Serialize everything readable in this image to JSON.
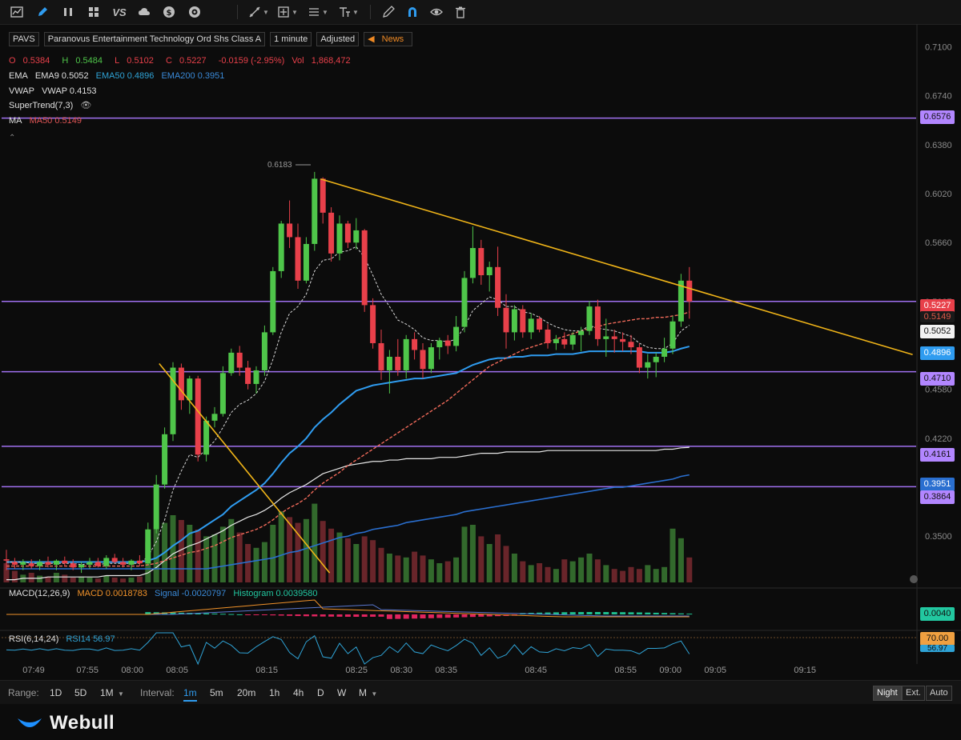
{
  "toolbar": {
    "left_icons": [
      "chart-icon",
      "pencil-icon",
      "bars-icon",
      "grid-icon",
      "vs-icon",
      "cloud-icon",
      "dollar-icon",
      "target-icon"
    ],
    "vs_label": "VS",
    "right_icons": [
      "trendline-icon",
      "measure-icon",
      "fib-icon",
      "text-icon",
      "brush-icon",
      "magnet-icon",
      "eye-icon",
      "trash-icon"
    ]
  },
  "header": {
    "symbol": "PAVS",
    "name": "Paranovus Entertainment Technology Ord Shs Class A",
    "interval": "1 minute",
    "adjusted": "Adjusted",
    "news": "News"
  },
  "ohlc": {
    "o_label": "O",
    "o": "0.5384",
    "h_label": "H",
    "h": "0.5484",
    "l_label": "L",
    "l": "0.5102",
    "c_label": "C",
    "c": "0.5227",
    "change": "-0.0159 (-2.95%)",
    "vol_label": "Vol",
    "vol": "1,868,472"
  },
  "indicators": {
    "ema_label": "EMA",
    "ema9": "EMA9 0.5052",
    "ema50": "EMA50 0.4896",
    "ema200": "EMA200 0.3951",
    "vwap_label": "VWAP",
    "vwap": "VWAP 0.4153",
    "supertrend": "SuperTrend(7,3)",
    "ma_label": "MA",
    "ma50": "MA50 0.5149"
  },
  "macd_info": {
    "label": "MACD(12,26,9)",
    "macd": "MACD 0.0018783",
    "signal": "Signal -0.0020797",
    "histogram": "Histogram 0.0039580",
    "tag": "0.0040"
  },
  "rsi_info": {
    "label": "RSI(6,14,24)",
    "rsi14": "RSI14 56.97",
    "tag": "70.00",
    "tag2": "56.97"
  },
  "price_tags": {
    "t6576": "0.6576",
    "t5227": "0.5227",
    "t5149": "0.5149",
    "t5052": "0.5052",
    "t4896": "0.4896",
    "t4710": "0.4710",
    "t4161": "0.4161",
    "t3951": "0.3951",
    "t3864": "0.3864"
  },
  "high_label": "0.6183",
  "colors": {
    "up": "#4fc64a",
    "down": "#e8404a",
    "hline": "#a070f0",
    "trend": "#f0b418",
    "ema9": "#d8d8d8",
    "ema50": "#2f9cf0",
    "ema200": "#2a6fd0",
    "vwap": "#e8e8e8",
    "ma50": "#f06a5a"
  },
  "chart_data": {
    "type": "candlestick",
    "y_ticks": [
      "0.7100",
      "0.6740",
      "0.6380",
      "0.6020",
      "0.5660",
      "0.5227",
      "0.4580",
      "0.4220",
      "0.3500"
    ],
    "ylim": [
      0.316,
      0.728
    ],
    "x_ticks": [
      "07:49",
      "07:55",
      "08:00",
      "08:05",
      "08:15",
      "08:25",
      "08:30",
      "08:35",
      "08:45",
      "08:55",
      "09:00",
      "09:05",
      "09:15"
    ],
    "horizontal_lines": [
      0.6576,
      0.5227,
      0.471,
      0.4161,
      0.3864
    ],
    "trendlines": [
      {
        "from": [
          "08:03",
          0.477
        ],
        "to": [
          "08:22",
          0.323
        ]
      },
      {
        "from": [
          "08:21",
          0.6128
        ],
        "to": [
          "09:27",
          0.4836
        ]
      }
    ],
    "candles": [
      {
        "o": 0.333,
        "h": 0.34,
        "l": 0.325,
        "c": 0.332
      },
      {
        "o": 0.331,
        "h": 0.334,
        "l": 0.326,
        "c": 0.329
      },
      {
        "o": 0.329,
        "h": 0.333,
        "l": 0.325,
        "c": 0.331
      },
      {
        "o": 0.33,
        "h": 0.333,
        "l": 0.326,
        "c": 0.328
      },
      {
        "o": 0.328,
        "h": 0.333,
        "l": 0.325,
        "c": 0.331
      },
      {
        "o": 0.331,
        "h": 0.335,
        "l": 0.327,
        "c": 0.329
      },
      {
        "o": 0.329,
        "h": 0.333,
        "l": 0.325,
        "c": 0.332
      },
      {
        "o": 0.332,
        "h": 0.335,
        "l": 0.328,
        "c": 0.33
      },
      {
        "o": 0.33,
        "h": 0.333,
        "l": 0.325,
        "c": 0.327
      },
      {
        "o": 0.327,
        "h": 0.331,
        "l": 0.323,
        "c": 0.329
      },
      {
        "o": 0.329,
        "h": 0.334,
        "l": 0.326,
        "c": 0.331
      },
      {
        "o": 0.331,
        "h": 0.334,
        "l": 0.327,
        "c": 0.328
      },
      {
        "o": 0.328,
        "h": 0.336,
        "l": 0.326,
        "c": 0.334
      },
      {
        "o": 0.334,
        "h": 0.337,
        "l": 0.33,
        "c": 0.331
      },
      {
        "o": 0.331,
        "h": 0.334,
        "l": 0.327,
        "c": 0.329
      },
      {
        "o": 0.329,
        "h": 0.333,
        "l": 0.325,
        "c": 0.332
      },
      {
        "o": 0.332,
        "h": 0.336,
        "l": 0.328,
        "c": 0.33
      },
      {
        "o": 0.33,
        "h": 0.36,
        "l": 0.329,
        "c": 0.355
      },
      {
        "o": 0.355,
        "h": 0.395,
        "l": 0.352,
        "c": 0.388
      },
      {
        "o": 0.388,
        "h": 0.43,
        "l": 0.385,
        "c": 0.425
      },
      {
        "o": 0.425,
        "h": 0.478,
        "l": 0.42,
        "c": 0.474
      },
      {
        "o": 0.474,
        "h": 0.477,
        "l": 0.443,
        "c": 0.45
      },
      {
        "o": 0.45,
        "h": 0.468,
        "l": 0.44,
        "c": 0.466
      },
      {
        "o": 0.466,
        "h": 0.468,
        "l": 0.405,
        "c": 0.41
      },
      {
        "o": 0.41,
        "h": 0.438,
        "l": 0.405,
        "c": 0.435
      },
      {
        "o": 0.435,
        "h": 0.445,
        "l": 0.43,
        "c": 0.44
      },
      {
        "o": 0.44,
        "h": 0.475,
        "l": 0.438,
        "c": 0.47
      },
      {
        "o": 0.47,
        "h": 0.488,
        "l": 0.468,
        "c": 0.485
      },
      {
        "o": 0.485,
        "h": 0.49,
        "l": 0.468,
        "c": 0.474
      },
      {
        "o": 0.474,
        "h": 0.479,
        "l": 0.458,
        "c": 0.462
      },
      {
        "o": 0.462,
        "h": 0.475,
        "l": 0.455,
        "c": 0.472
      },
      {
        "o": 0.472,
        "h": 0.505,
        "l": 0.468,
        "c": 0.5
      },
      {
        "o": 0.5,
        "h": 0.548,
        "l": 0.498,
        "c": 0.545
      },
      {
        "o": 0.545,
        "h": 0.582,
        "l": 0.54,
        "c": 0.58
      },
      {
        "o": 0.58,
        "h": 0.597,
        "l": 0.562,
        "c": 0.57
      },
      {
        "o": 0.57,
        "h": 0.58,
        "l": 0.532,
        "c": 0.538
      },
      {
        "o": 0.538,
        "h": 0.57,
        "l": 0.536,
        "c": 0.565
      },
      {
        "o": 0.565,
        "h": 0.618,
        "l": 0.56,
        "c": 0.613
      },
      {
        "o": 0.613,
        "h": 0.614,
        "l": 0.58,
        "c": 0.588
      },
      {
        "o": 0.588,
        "h": 0.592,
        "l": 0.552,
        "c": 0.558
      },
      {
        "o": 0.558,
        "h": 0.586,
        "l": 0.553,
        "c": 0.58
      },
      {
        "o": 0.58,
        "h": 0.582,
        "l": 0.562,
        "c": 0.566
      },
      {
        "o": 0.566,
        "h": 0.584,
        "l": 0.561,
        "c": 0.575
      },
      {
        "o": 0.575,
        "h": 0.576,
        "l": 0.515,
        "c": 0.52
      },
      {
        "o": 0.52,
        "h": 0.525,
        "l": 0.488,
        "c": 0.492
      },
      {
        "o": 0.492,
        "h": 0.502,
        "l": 0.465,
        "c": 0.472
      },
      {
        "o": 0.472,
        "h": 0.487,
        "l": 0.455,
        "c": 0.482
      },
      {
        "o": 0.482,
        "h": 0.495,
        "l": 0.468,
        "c": 0.472
      },
      {
        "o": 0.472,
        "h": 0.498,
        "l": 0.466,
        "c": 0.495
      },
      {
        "o": 0.495,
        "h": 0.5,
        "l": 0.48,
        "c": 0.487
      },
      {
        "o": 0.487,
        "h": 0.492,
        "l": 0.466,
        "c": 0.473
      },
      {
        "o": 0.473,
        "h": 0.492,
        "l": 0.47,
        "c": 0.489
      },
      {
        "o": 0.489,
        "h": 0.496,
        "l": 0.48,
        "c": 0.494
      },
      {
        "o": 0.494,
        "h": 0.498,
        "l": 0.484,
        "c": 0.49
      },
      {
        "o": 0.49,
        "h": 0.512,
        "l": 0.486,
        "c": 0.504
      },
      {
        "o": 0.504,
        "h": 0.545,
        "l": 0.5,
        "c": 0.54
      },
      {
        "o": 0.54,
        "h": 0.578,
        "l": 0.536,
        "c": 0.562
      },
      {
        "o": 0.562,
        "h": 0.568,
        "l": 0.535,
        "c": 0.542
      },
      {
        "o": 0.542,
        "h": 0.552,
        "l": 0.53,
        "c": 0.548
      },
      {
        "o": 0.548,
        "h": 0.563,
        "l": 0.512,
        "c": 0.518
      },
      {
        "o": 0.518,
        "h": 0.528,
        "l": 0.488,
        "c": 0.5
      },
      {
        "o": 0.5,
        "h": 0.52,
        "l": 0.494,
        "c": 0.517
      },
      {
        "o": 0.517,
        "h": 0.52,
        "l": 0.496,
        "c": 0.5
      },
      {
        "o": 0.5,
        "h": 0.514,
        "l": 0.495,
        "c": 0.51
      },
      {
        "o": 0.51,
        "h": 0.512,
        "l": 0.5,
        "c": 0.502
      },
      {
        "o": 0.502,
        "h": 0.506,
        "l": 0.488,
        "c": 0.492
      },
      {
        "o": 0.492,
        "h": 0.498,
        "l": 0.487,
        "c": 0.495
      },
      {
        "o": 0.495,
        "h": 0.5,
        "l": 0.488,
        "c": 0.491
      },
      {
        "o": 0.491,
        "h": 0.5,
        "l": 0.487,
        "c": 0.498
      },
      {
        "o": 0.498,
        "h": 0.504,
        "l": 0.486,
        "c": 0.501
      },
      {
        "o": 0.501,
        "h": 0.523,
        "l": 0.498,
        "c": 0.519
      },
      {
        "o": 0.519,
        "h": 0.524,
        "l": 0.49,
        "c": 0.495
      },
      {
        "o": 0.495,
        "h": 0.51,
        "l": 0.482,
        "c": 0.497
      },
      {
        "o": 0.497,
        "h": 0.502,
        "l": 0.485,
        "c": 0.495
      },
      {
        "o": 0.495,
        "h": 0.5,
        "l": 0.486,
        "c": 0.493
      },
      {
        "o": 0.493,
        "h": 0.498,
        "l": 0.484,
        "c": 0.489
      },
      {
        "o": 0.489,
        "h": 0.492,
        "l": 0.47,
        "c": 0.474
      },
      {
        "o": 0.474,
        "h": 0.484,
        "l": 0.466,
        "c": 0.478
      },
      {
        "o": 0.478,
        "h": 0.485,
        "l": 0.467,
        "c": 0.482
      },
      {
        "o": 0.482,
        "h": 0.496,
        "l": 0.478,
        "c": 0.488
      },
      {
        "o": 0.488,
        "h": 0.512,
        "l": 0.484,
        "c": 0.508
      },
      {
        "o": 0.508,
        "h": 0.543,
        "l": 0.504,
        "c": 0.538
      },
      {
        "o": 0.538,
        "h": 0.548,
        "l": 0.51,
        "c": 0.5227
      }
    ],
    "volumes": [
      0.2,
      0.12,
      0.08,
      0.1,
      0.07,
      0.06,
      0.1,
      0.08,
      0.05,
      0.06,
      0.05,
      0.04,
      0.07,
      0.05,
      0.04,
      0.05,
      0.06,
      0.42,
      0.55,
      0.62,
      0.7,
      0.65,
      0.6,
      0.55,
      0.48,
      0.5,
      0.58,
      0.66,
      0.52,
      0.4,
      0.36,
      0.42,
      0.6,
      0.74,
      0.68,
      0.62,
      0.66,
      0.82,
      0.64,
      0.56,
      0.52,
      0.46,
      0.4,
      0.48,
      0.44,
      0.36,
      0.3,
      0.28,
      0.26,
      0.32,
      0.28,
      0.24,
      0.2,
      0.22,
      0.26,
      0.58,
      0.6,
      0.48,
      0.4,
      0.5,
      0.38,
      0.3,
      0.22,
      0.18,
      0.2,
      0.16,
      0.14,
      0.24,
      0.22,
      0.26,
      0.3,
      0.24,
      0.18,
      0.14,
      0.12,
      0.16,
      0.14,
      0.18,
      0.14,
      0.16,
      0.56,
      0.46,
      0.26
    ],
    "ema9": [
      0.331,
      0.331,
      0.331,
      0.33,
      0.33,
      0.33,
      0.33,
      0.33,
      0.33,
      0.329,
      0.33,
      0.329,
      0.33,
      0.33,
      0.33,
      0.33,
      0.33,
      0.335,
      0.346,
      0.362,
      0.384,
      0.398,
      0.41,
      0.408,
      0.414,
      0.42,
      0.43,
      0.441,
      0.447,
      0.45,
      0.455,
      0.464,
      0.48,
      0.5,
      0.514,
      0.519,
      0.528,
      0.545,
      0.553,
      0.554,
      0.559,
      0.56,
      0.563,
      0.555,
      0.542,
      0.528,
      0.519,
      0.509,
      0.506,
      0.502,
      0.496,
      0.494,
      0.494,
      0.493,
      0.495,
      0.504,
      0.516,
      0.521,
      0.526,
      0.524,
      0.519,
      0.519,
      0.515,
      0.514,
      0.511,
      0.507,
      0.504,
      0.502,
      0.501,
      0.501,
      0.505,
      0.503,
      0.502,
      0.501,
      0.499,
      0.497,
      0.492,
      0.489,
      0.488,
      0.488,
      0.492,
      0.501,
      0.5052
    ],
    "ema50": [
      0.331,
      0.331,
      0.331,
      0.331,
      0.331,
      0.331,
      0.331,
      0.331,
      0.331,
      0.331,
      0.331,
      0.331,
      0.331,
      0.331,
      0.331,
      0.331,
      0.331,
      0.332,
      0.334,
      0.338,
      0.343,
      0.347,
      0.352,
      0.354,
      0.358,
      0.362,
      0.366,
      0.372,
      0.376,
      0.38,
      0.384,
      0.389,
      0.396,
      0.404,
      0.411,
      0.416,
      0.422,
      0.43,
      0.436,
      0.441,
      0.447,
      0.452,
      0.457,
      0.459,
      0.461,
      0.462,
      0.463,
      0.464,
      0.465,
      0.466,
      0.466,
      0.467,
      0.468,
      0.469,
      0.47,
      0.473,
      0.476,
      0.478,
      0.48,
      0.481,
      0.481,
      0.482,
      0.482,
      0.483,
      0.483,
      0.483,
      0.484,
      0.484,
      0.484,
      0.485,
      0.486,
      0.486,
      0.486,
      0.486,
      0.486,
      0.486,
      0.486,
      0.485,
      0.485,
      0.485,
      0.486,
      0.488,
      0.4896
    ],
    "ema200": [
      0.326,
      0.326,
      0.326,
      0.326,
      0.326,
      0.326,
      0.326,
      0.326,
      0.326,
      0.326,
      0.326,
      0.326,
      0.326,
      0.326,
      0.326,
      0.326,
      0.326,
      0.326,
      0.326,
      0.326,
      0.326,
      0.326,
      0.326,
      0.326,
      0.326,
      0.327,
      0.328,
      0.329,
      0.33,
      0.331,
      0.332,
      0.333,
      0.334,
      0.336,
      0.338,
      0.339,
      0.341,
      0.343,
      0.345,
      0.347,
      0.349,
      0.35,
      0.352,
      0.353,
      0.355,
      0.356,
      0.357,
      0.358,
      0.36,
      0.361,
      0.362,
      0.363,
      0.364,
      0.365,
      0.366,
      0.368,
      0.369,
      0.37,
      0.371,
      0.372,
      0.373,
      0.374,
      0.375,
      0.376,
      0.377,
      0.378,
      0.379,
      0.38,
      0.381,
      0.382,
      0.383,
      0.384,
      0.385,
      0.386,
      0.386,
      0.387,
      0.388,
      0.389,
      0.39,
      0.391,
      0.392,
      0.394,
      0.3951
    ],
    "vwap": [
      0.318,
      0.318,
      0.319,
      0.319,
      0.319,
      0.32,
      0.32,
      0.32,
      0.32,
      0.32,
      0.32,
      0.32,
      0.321,
      0.321,
      0.321,
      0.321,
      0.321,
      0.323,
      0.327,
      0.332,
      0.337,
      0.34,
      0.343,
      0.345,
      0.348,
      0.351,
      0.354,
      0.358,
      0.361,
      0.364,
      0.366,
      0.369,
      0.373,
      0.378,
      0.382,
      0.385,
      0.388,
      0.392,
      0.396,
      0.398,
      0.4,
      0.402,
      0.403,
      0.404,
      0.405,
      0.405,
      0.406,
      0.406,
      0.407,
      0.407,
      0.407,
      0.407,
      0.408,
      0.408,
      0.408,
      0.409,
      0.41,
      0.411,
      0.411,
      0.411,
      0.412,
      0.412,
      0.412,
      0.412,
      0.412,
      0.413,
      0.413,
      0.413,
      0.413,
      0.413,
      0.413,
      0.413,
      0.413,
      0.413,
      0.413,
      0.413,
      0.413,
      0.413,
      0.413,
      0.414,
      0.414,
      0.415,
      0.4153
    ],
    "ma50": [
      0.328,
      0.328,
      0.328,
      0.328,
      0.328,
      0.328,
      0.328,
      0.328,
      0.328,
      0.328,
      0.328,
      0.328,
      0.328,
      0.328,
      0.328,
      0.328,
      0.328,
      0.329,
      0.33,
      0.332,
      0.334,
      0.336,
      0.338,
      0.339,
      0.341,
      0.343,
      0.346,
      0.349,
      0.351,
      0.353,
      0.355,
      0.358,
      0.362,
      0.367,
      0.371,
      0.374,
      0.378,
      0.384,
      0.389,
      0.393,
      0.397,
      0.402,
      0.406,
      0.41,
      0.414,
      0.418,
      0.422,
      0.426,
      0.43,
      0.434,
      0.438,
      0.442,
      0.446,
      0.45,
      0.455,
      0.46,
      0.465,
      0.47,
      0.475,
      0.478,
      0.481,
      0.484,
      0.487,
      0.489,
      0.491,
      0.493,
      0.495,
      0.497,
      0.499,
      0.501,
      0.503,
      0.504,
      0.506,
      0.507,
      0.508,
      0.509,
      0.51,
      0.51,
      0.511,
      0.511,
      0.512,
      0.513,
      0.5149
    ]
  }
}
